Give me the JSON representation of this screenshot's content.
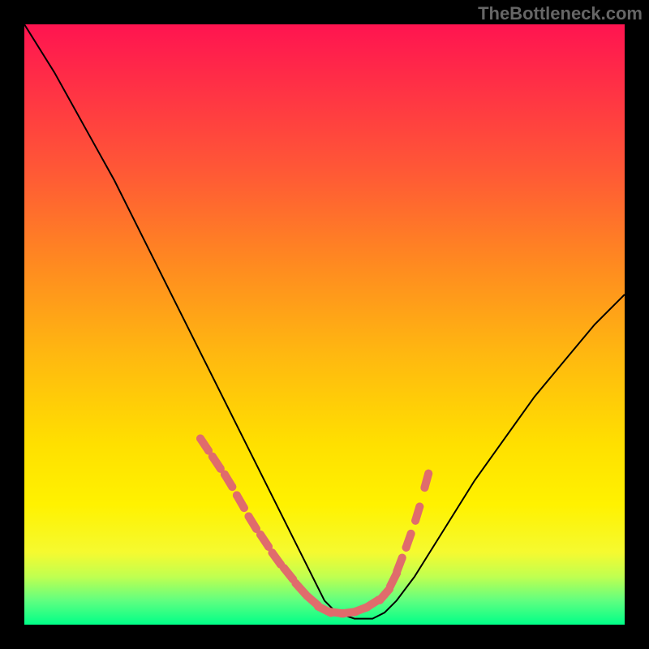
{
  "watermark": "TheBottleneck.com",
  "chart_data": {
    "type": "line",
    "title": "",
    "xlabel": "",
    "ylabel": "",
    "xlim": [
      0,
      100
    ],
    "ylim": [
      0,
      100
    ],
    "series": [
      {
        "name": "curve",
        "x": [
          0,
          5,
          10,
          15,
          20,
          25,
          30,
          35,
          40,
          45,
          48,
          50,
          52,
          55,
          58,
          60,
          62,
          65,
          70,
          75,
          80,
          85,
          90,
          95,
          100
        ],
        "y": [
          100,
          92,
          83,
          74,
          64,
          54,
          44,
          34,
          24,
          14,
          8,
          4,
          2,
          1,
          1,
          2,
          4,
          8,
          16,
          24,
          31,
          38,
          44,
          50,
          55
        ]
      }
    ],
    "markers": {
      "name": "highlight-segment",
      "color": "#e06c6c",
      "points_x": [
        30,
        32,
        34,
        36,
        38,
        40,
        42,
        44,
        46,
        48,
        50,
        52,
        54,
        56,
        58,
        60,
        61.5,
        62.5,
        64,
        65.5,
        67
      ],
      "points_y": [
        30,
        27,
        24,
        20.5,
        17,
        14,
        11,
        8.5,
        6,
        4,
        2.5,
        2,
        2,
        2.5,
        3.5,
        5,
        7.5,
        10,
        14,
        18.5,
        24
      ]
    },
    "gradient_background": {
      "direction": "vertical",
      "stops": [
        {
          "pos": 0.0,
          "color": "#ff1450"
        },
        {
          "pos": 0.25,
          "color": "#ff5a35"
        },
        {
          "pos": 0.55,
          "color": "#ffb810"
        },
        {
          "pos": 0.8,
          "color": "#fff200"
        },
        {
          "pos": 1.0,
          "color": "#00ff88"
        }
      ]
    }
  }
}
